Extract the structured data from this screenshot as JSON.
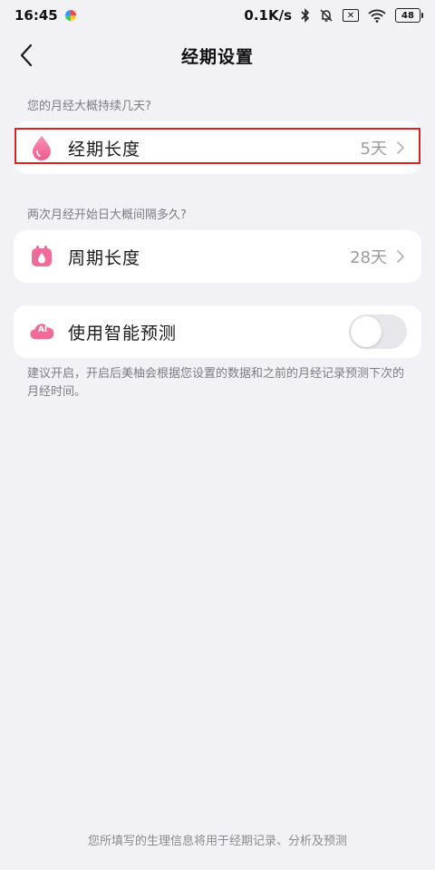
{
  "status_bar": {
    "time": "16:45",
    "network_speed": "0.1K/s",
    "battery": "48",
    "sim_indicator": "✕"
  },
  "nav": {
    "title": "经期设置"
  },
  "period_section": {
    "hint": "您的月经大概持续几天?",
    "label": "经期长度",
    "value": "5天"
  },
  "cycle_section": {
    "hint": "两次月经开始日大概间隔多久?",
    "label": "周期长度",
    "value": "28天"
  },
  "prediction_section": {
    "icon_text": "AI",
    "label": "使用智能预测",
    "toggle_on": false,
    "description": "建议开启，开启后美柚会根据您设置的数据和之前的月经记录预测下次的月经时间。"
  },
  "footer": {
    "text": "您所填写的生理信息将用于经期记录、分析及预测"
  },
  "colors": {
    "accent_pink": "#f06a9a",
    "background": "#f2f1f6",
    "highlight_red": "#e02020"
  }
}
